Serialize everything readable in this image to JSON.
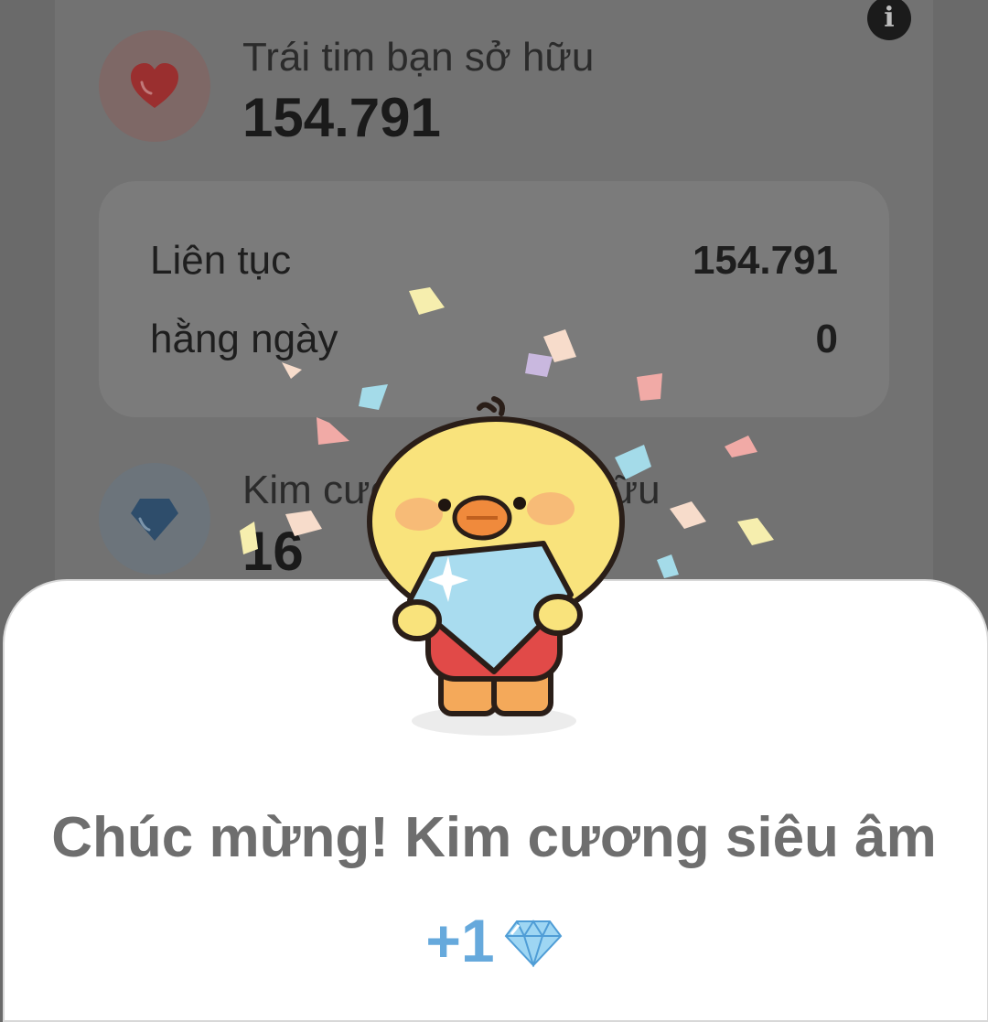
{
  "hearts": {
    "label": "Trái tim bạn sở hữu",
    "value": "154.791"
  },
  "breakdown": [
    {
      "label": "Liên tục",
      "value": "154.791"
    },
    {
      "label": "hằng ngày",
      "value": "0"
    }
  ],
  "diamonds": {
    "label": "Kim cương bạn sở hữu",
    "value": "16"
  },
  "popup": {
    "title": "Chúc mừng! Kim cương siêu âm",
    "reward": "+1"
  },
  "icons": {
    "info": "info-icon",
    "heart": "heart-icon",
    "diamond": "diamond-icon",
    "reward": "gem-icon"
  },
  "colors": {
    "overlay": "#6a6a6a",
    "title": "#6e6e6e",
    "reward": "#66a9dc",
    "heart": "#9a2f2f",
    "diamond": "#2e4d6b"
  }
}
